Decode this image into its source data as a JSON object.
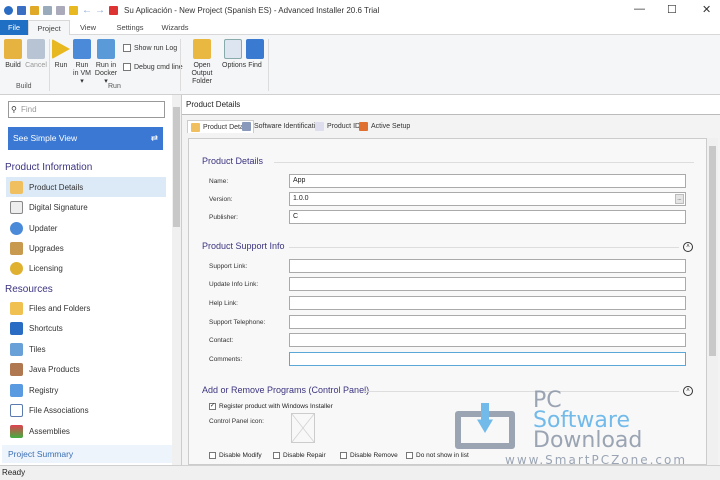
{
  "window": {
    "title": "Su Aplicación - New Project (Spanish ES) - Advanced Installer 20.6 Trial",
    "min": "—",
    "max": "☐",
    "close": "✕"
  },
  "tabs": [
    "File",
    "Project",
    "View",
    "Settings",
    "Wizards"
  ],
  "ribbon": {
    "build": "Build",
    "cancel": "Cancel",
    "run": "Run",
    "run_vm": "Run in VM ▾",
    "run_docker": "Run in Docker ▾",
    "show_log": "Show run Log",
    "debug": "Debug cmd line",
    "open_output": "Open Output Folder",
    "options": "Options",
    "find": "Find",
    "group_build": "Build",
    "group_run": "Run"
  },
  "left": {
    "find_placeholder": "Find",
    "simple_view": "See Simple View",
    "sections": [
      {
        "title": "Product Information",
        "items": [
          "Product Details",
          "Digital Signature",
          "Updater",
          "Upgrades",
          "Licensing"
        ]
      },
      {
        "title": "Resources",
        "items": [
          "Files and Folders",
          "Shortcuts",
          "Tiles",
          "Java Products",
          "Registry",
          "File Associations",
          "Assemblies"
        ]
      }
    ],
    "summary": "Project Summary"
  },
  "main": {
    "header": "Product Details",
    "tabs": [
      "Product Details",
      "Software Identification",
      "Product IDs",
      "Active Setup"
    ],
    "sec1": "Product Details",
    "fields1": [
      {
        "label": "Name:",
        "value": "App"
      },
      {
        "label": "Version:",
        "value": "1.0.0"
      },
      {
        "label": "Publisher:",
        "value": "C"
      }
    ],
    "version_btn": "...",
    "sec2": "Product Support Info",
    "fields2": [
      "Support Link:",
      "Update Info Link:",
      "Help Link:",
      "Support Telephone:",
      "Contact:",
      "Comments:"
    ],
    "sec3": "Add or Remove Programs (Control Panel)",
    "register": "Register product with Windows Installer",
    "cp_icon": "Control Panel icon:",
    "bottom_checks": [
      "Disable Modify",
      "Disable Repair",
      "Disable Remove",
      "Do not show in list"
    ]
  },
  "status": "Ready",
  "watermark": {
    "l1": "PC",
    "l2": "Software",
    "l3": "Download",
    "url": "www.SmartPCZone.com"
  }
}
